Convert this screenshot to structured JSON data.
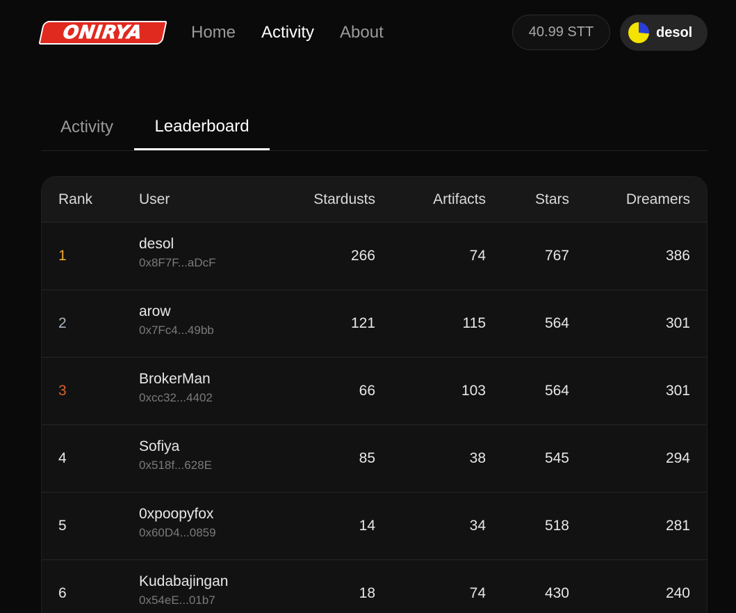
{
  "app": {
    "logo_text": "ONIRYA"
  },
  "nav": {
    "items": [
      "Home",
      "Activity",
      "About"
    ]
  },
  "wallet": {
    "balance": "40.99 STT",
    "username": "desol"
  },
  "tabs": [
    "Activity",
    "Leaderboard"
  ],
  "table": {
    "headers": {
      "rank": "Rank",
      "user": "User",
      "stardusts": "Stardusts",
      "artifacts": "Artifacts",
      "stars": "Stars",
      "dreamers": "Dreamers"
    },
    "rows": [
      {
        "rank": "1",
        "name": "desol",
        "address": "0x8F7F...aDcF",
        "stardusts": "266",
        "artifacts": "74",
        "stars": "767",
        "dreamers": "386"
      },
      {
        "rank": "2",
        "name": "arow",
        "address": "0x7Fc4...49bb",
        "stardusts": "121",
        "artifacts": "115",
        "stars": "564",
        "dreamers": "301"
      },
      {
        "rank": "3",
        "name": "BrokerMan",
        "address": "0xcc32...4402",
        "stardusts": "66",
        "artifacts": "103",
        "stars": "564",
        "dreamers": "301"
      },
      {
        "rank": "4",
        "name": "Sofiya",
        "address": "0x518f...628E",
        "stardusts": "85",
        "artifacts": "38",
        "stars": "545",
        "dreamers": "294"
      },
      {
        "rank": "5",
        "name": "0xpoopyfox",
        "address": "0x60D4...0859",
        "stardusts": "14",
        "artifacts": "34",
        "stars": "518",
        "dreamers": "281"
      },
      {
        "rank": "6",
        "name": "Kudabajingan",
        "address": "0x54eE...01b7",
        "stardusts": "18",
        "artifacts": "74",
        "stars": "430",
        "dreamers": "240"
      }
    ]
  },
  "colors": {
    "rank_gold": "#f0a832",
    "rank_silver": "#a9b4c2",
    "rank_bronze": "#d9622b",
    "logo_red": "#e02a20"
  }
}
